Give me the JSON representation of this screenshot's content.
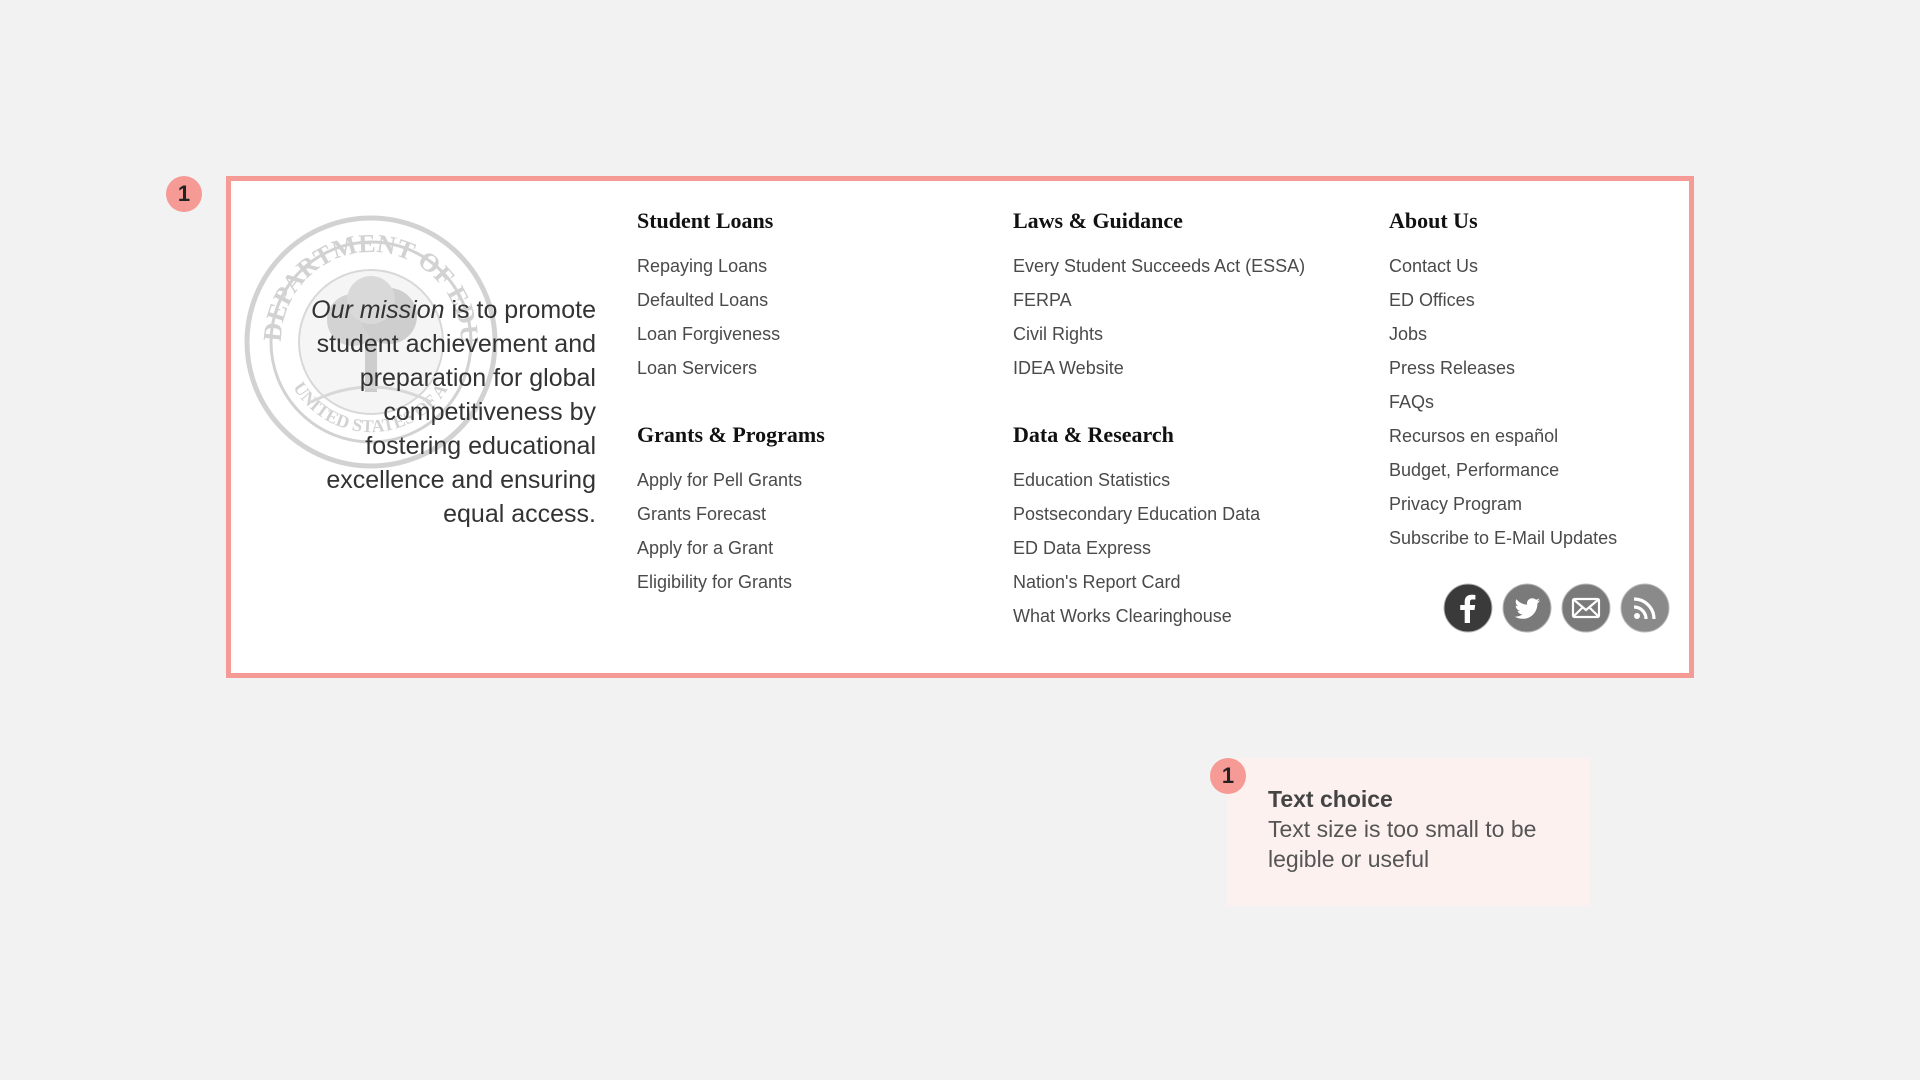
{
  "annotation_number": "1",
  "mission": {
    "lead_italic": "Our mission",
    "rest": " is to promote student achievement and preparation for global competitiveness by fostering educational excellence and ensuring equal access."
  },
  "seal": {
    "text_top": "DEPARTMENT OF EDUCATION",
    "text_bottom": "UNITED STATES OF AMERICA"
  },
  "columns": [
    [
      {
        "heading": "Student Loans",
        "links": [
          "Repaying Loans",
          "Defaulted Loans",
          "Loan Forgiveness",
          "Loan Servicers"
        ]
      },
      {
        "heading": "Grants & Programs",
        "links": [
          "Apply for Pell Grants",
          "Grants Forecast",
          "Apply for a Grant",
          "Eligibility for Grants"
        ]
      }
    ],
    [
      {
        "heading": "Laws & Guidance",
        "links": [
          "Every Student Succeeds Act (ESSA)",
          "FERPA",
          "Civil Rights",
          "IDEA Website"
        ]
      },
      {
        "heading": "Data & Research",
        "links": [
          "Education Statistics",
          "Postsecondary Education Data",
          "ED Data Express",
          "Nation's Report Card",
          "What Works Clearinghouse"
        ]
      }
    ],
    [
      {
        "heading": "About Us",
        "links": [
          "Contact Us",
          "ED Offices",
          "Jobs",
          "Press Releases",
          "FAQs",
          "Recursos en español",
          "Budget, Performance",
          "Privacy Program",
          "Subscribe to E-Mail Updates"
        ]
      }
    ]
  ],
  "social": [
    {
      "icon": "facebook-icon",
      "color": "#3a3a3a"
    },
    {
      "icon": "twitter-icon",
      "color": "#7a7a7a"
    },
    {
      "icon": "email-icon",
      "color": "#7a7a7a"
    },
    {
      "icon": "rss-icon",
      "color": "#8a8a8a"
    }
  ],
  "note": {
    "title": "Text choice",
    "body": "Text size is too small to be legible or useful"
  },
  "colors": {
    "highlight": "#f59a95",
    "note_background": "#fdf1ef",
    "page_background": "#f2f2f2"
  }
}
